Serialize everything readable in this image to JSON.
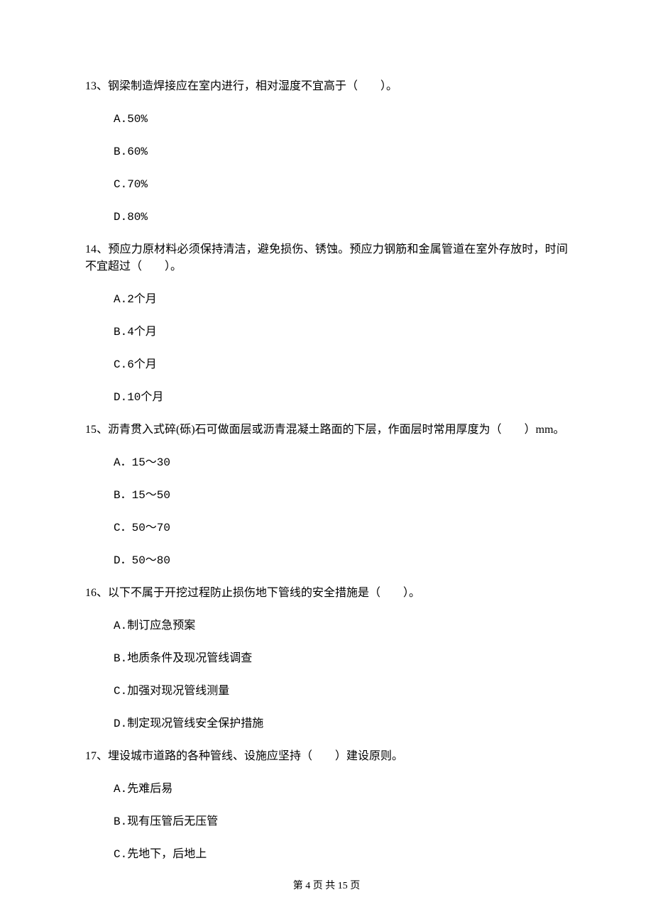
{
  "q13": {
    "stem": "13、钢梁制造焊接应在室内进行，相对湿度不宜高于（　　）。",
    "a": "A.50%",
    "b": "B.60%",
    "c": "C.70%",
    "d": "D.80%"
  },
  "q14": {
    "stem": "14、预应力原材料必须保持清洁，避免损伤、锈蚀。预应力钢筋和金属管道在室外存放时，时间不宜超过（　　）。",
    "a": "A.2个月",
    "b": "B.4个月",
    "c": "C.6个月",
    "d": "D.10个月"
  },
  "q15": {
    "stem": "15、沥青贯入式碎(砾)石可做面层或沥青混凝土路面的下层，作面层时常用厚度为（　　）mm。",
    "a": "A．15～30",
    "b": "B．15～50",
    "c": "C．50～70",
    "d": "D．50～80"
  },
  "q16": {
    "stem": "16、以下不属于开挖过程防止损伤地下管线的安全措施是（　　）。",
    "a": "A.制订应急预案",
    "b": "B.地质条件及现况管线调查",
    "c": "C.加强对现况管线测量",
    "d": "D.制定现况管线安全保护措施"
  },
  "q17": {
    "stem": "17、埋设城市道路的各种管线、设施应坚持（　　）建设原则。",
    "a": "A.先难后易",
    "b": "B.现有压管后无压管",
    "c": "C.先地下，后地上"
  },
  "footer": "第 4 页 共 15 页"
}
